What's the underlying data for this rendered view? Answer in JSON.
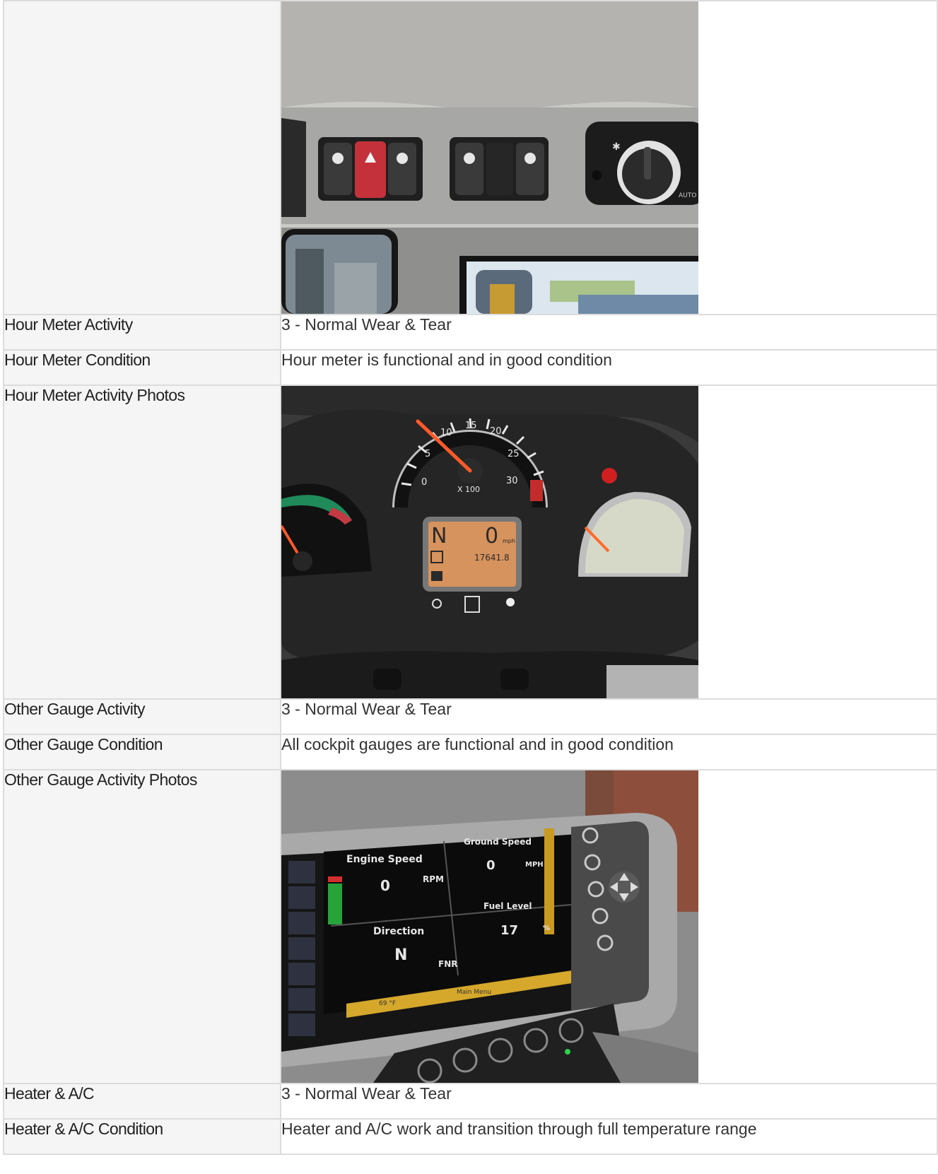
{
  "rows": [
    {
      "label": "",
      "photo": "cab-overhead-switch-panel-photo"
    },
    {
      "label": "Hour Meter Activity",
      "value": "3 - Normal Wear & Tear"
    },
    {
      "label": "Hour Meter Condition",
      "value": "Hour meter is functional and in good condition"
    },
    {
      "label": "Hour Meter Activity Photos",
      "photo": "instrument-cluster-photo"
    },
    {
      "label": "Other Gauge Activity",
      "value": "3 - Normal Wear & Tear"
    },
    {
      "label": "Other Gauge Condition",
      "value": "All cockpit gauges are functional and in good condition"
    },
    {
      "label": "Other Gauge Activity Photos",
      "photo": "display-monitor-photo"
    },
    {
      "label": "Heater & A/C",
      "value": "3 - Normal Wear & Tear"
    },
    {
      "label": "Heater & A/C Condition",
      "value": "Heater and A/C work and transition through full temperature range"
    }
  ],
  "photos": {
    "switch_panel": {
      "knob_label": "AUTO"
    },
    "instrument_cluster": {
      "tach_ticks": [
        "0",
        "5",
        "10",
        "15",
        "20",
        "25",
        "30"
      ],
      "tach_multiplier": "X 100",
      "lcd_gear": "N",
      "lcd_speed": "0",
      "lcd_speed_unit": "mph",
      "lcd_hours": "17641.8"
    },
    "display_monitor": {
      "engine_speed_title": "Engine Speed",
      "engine_speed_value": "0",
      "engine_speed_unit": "RPM",
      "ground_speed_title": "Ground Speed",
      "ground_speed_value": "0",
      "ground_speed_unit": "MPH",
      "direction_title": "Direction",
      "direction_value": "N",
      "direction_unit": "FNR",
      "fuel_level_title": "Fuel Level",
      "fuel_level_value": "17",
      "fuel_level_unit": "%",
      "temperature": "69 °F",
      "menu_label": "Main Menu"
    }
  },
  "colors": {
    "label_bg": "#f5f5f5",
    "border": "#dcdcdc",
    "text": "#333333"
  }
}
